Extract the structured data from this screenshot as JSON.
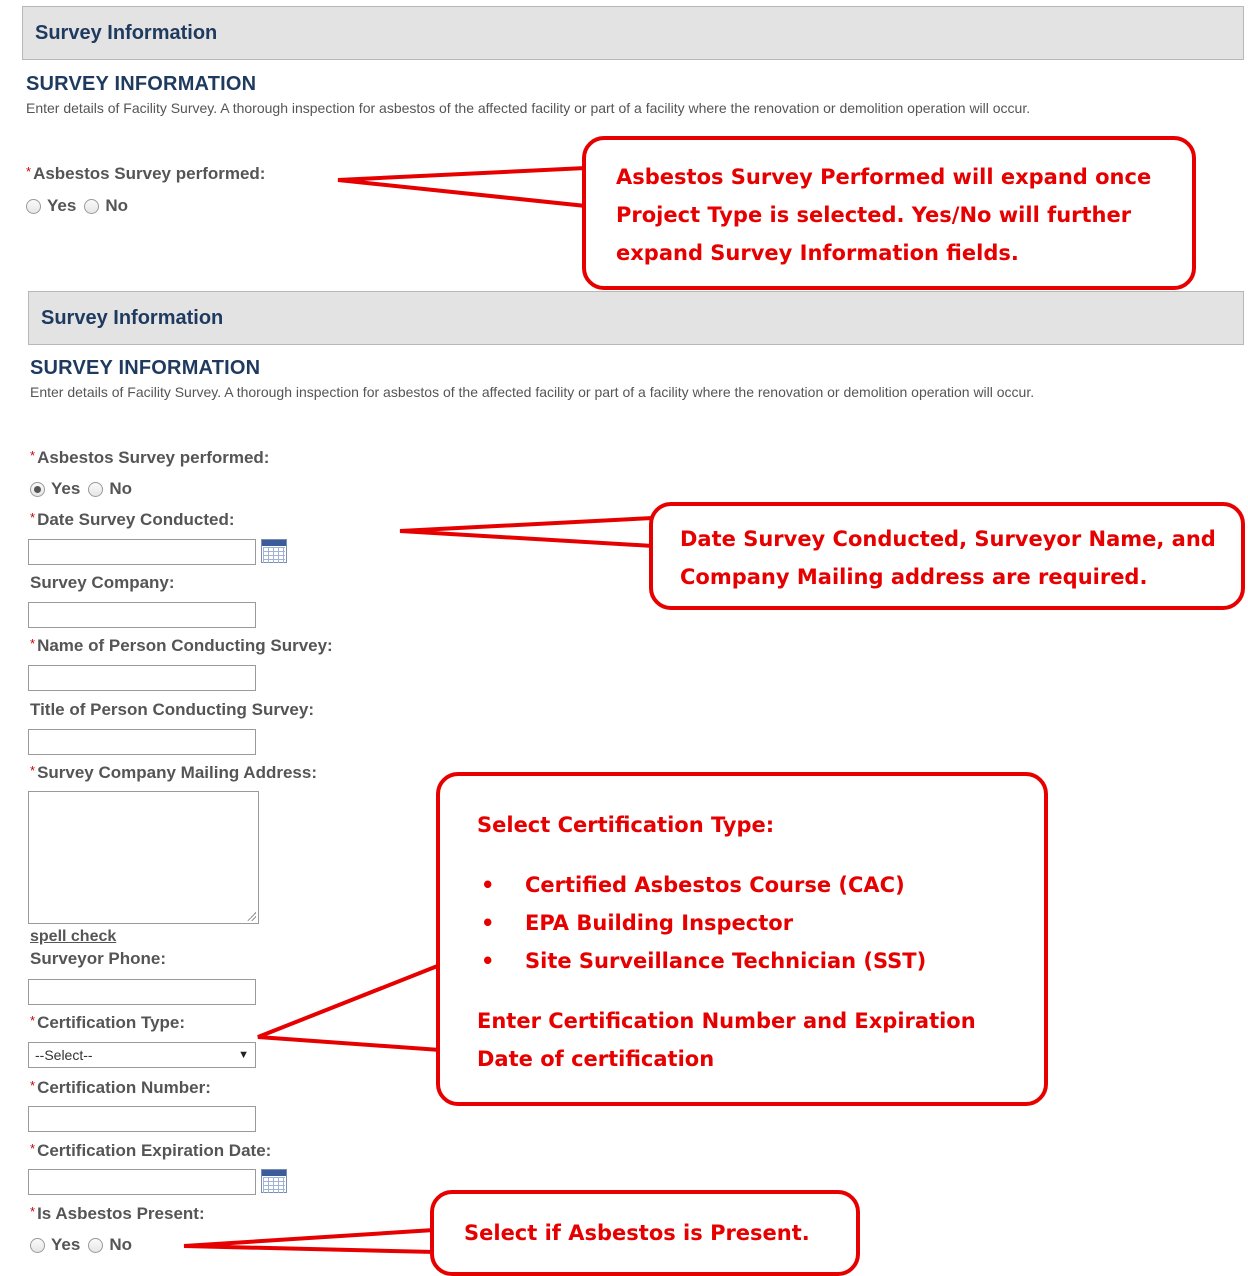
{
  "panel1": {
    "header": "Survey Information",
    "title": "SURVEY INFORMATION",
    "desc": "Enter details of Facility Survey. A thorough inspection for asbestos of the affected facility or part of a facility where the renovation or demolition operation will occur.",
    "survey_performed_label": "Asbestos Survey performed:",
    "yes": "Yes",
    "no": "No"
  },
  "panel2": {
    "header": "Survey Information",
    "title": "SURVEY INFORMATION",
    "desc": "Enter details of Facility Survey. A thorough inspection for asbestos of the affected facility or part of a facility where the renovation or demolition operation will occur.",
    "survey_performed_label": "Asbestos Survey performed:",
    "survey_performed_value": "Yes",
    "yes": "Yes",
    "no": "No",
    "date_label": "Date Survey Conducted:",
    "company_label": "Survey Company:",
    "person_label": "Name of Person Conducting Survey:",
    "title_label": "Title of Person Conducting Survey:",
    "address_label": "Survey Company Mailing Address:",
    "spell_check": "spell check",
    "phone_label": "Surveyor Phone:",
    "cert_type_label": "Certification Type:",
    "cert_type_value": "--Select--",
    "cert_number_label": "Certification Number:",
    "cert_exp_label": "Certification Expiration Date:",
    "asbestos_present_label": "Is Asbestos Present:"
  },
  "callouts": {
    "c1": [
      "Asbestos Survey Performed will expand once",
      "Project Type is selected. Yes/No will further",
      "expand Survey Information fields."
    ],
    "c2": [
      "Date Survey Conducted, Surveyor Name, and",
      "Company Mailing address are required."
    ],
    "c3": {
      "heading": "Select Certification Type:",
      "items": [
        "Certified Asbestos Course (CAC)",
        "EPA Building Inspector",
        "Site Surveillance Technician (SST)"
      ],
      "footer": [
        "Enter Certification Number and Expiration",
        "Date of certification"
      ]
    },
    "c4": "Select if Asbestos is Present."
  },
  "colors": {
    "callout": "#e60000",
    "header_bg": "#e3e3e3",
    "title": "#1f3a5f"
  },
  "icons": {
    "calendar": "calendar-icon",
    "dropdown": "dropdown-arrow-icon"
  }
}
